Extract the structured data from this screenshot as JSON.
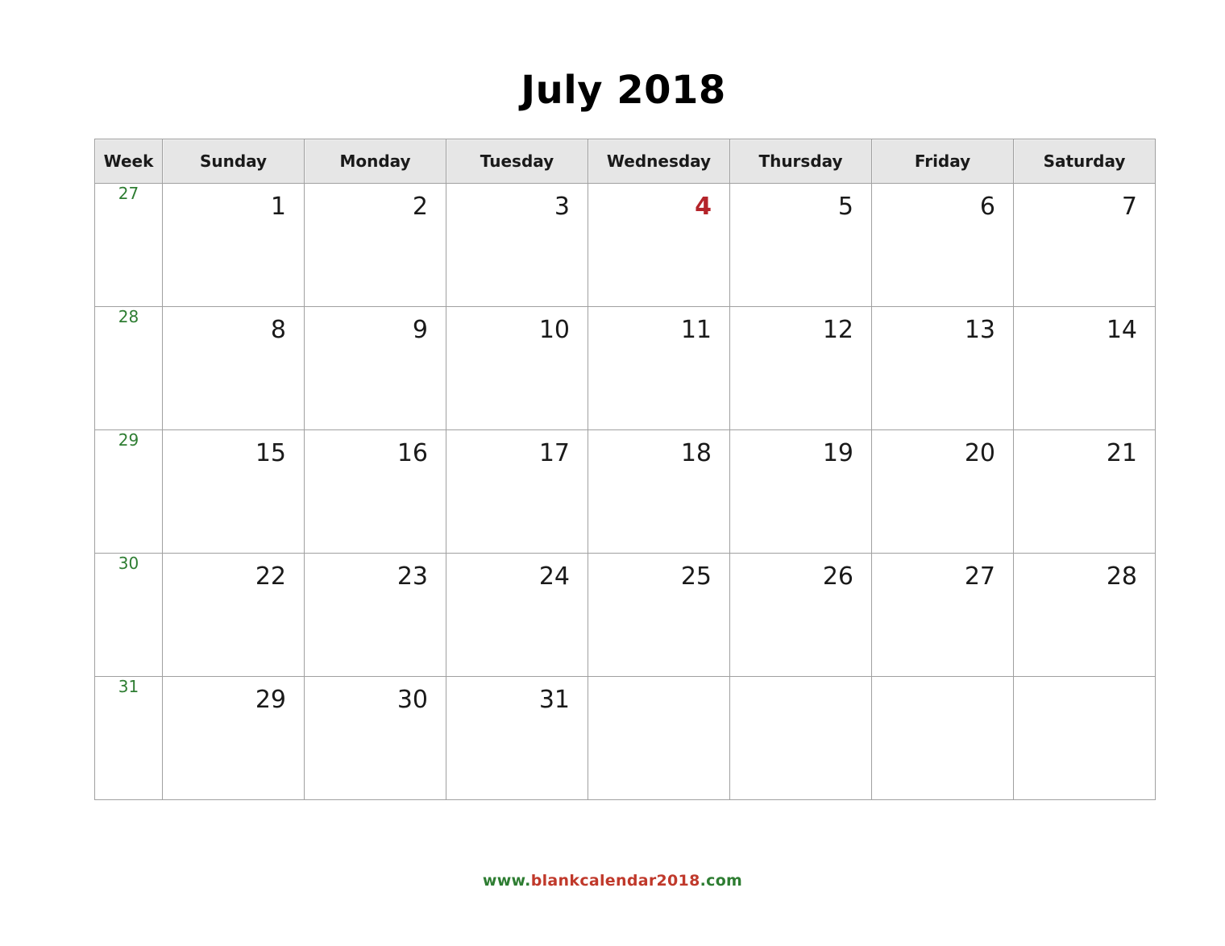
{
  "title": "July 2018",
  "headers": {
    "week": "Week",
    "days": [
      "Sunday",
      "Monday",
      "Tuesday",
      "Wednesday",
      "Thursday",
      "Friday",
      "Saturday"
    ]
  },
  "colors": {
    "week_number": "#2e7d32",
    "holiday": "#b4242a",
    "header_bg": "#e6e6e6",
    "grid_border": "#a0a0a0",
    "text": "#1a1a1a",
    "footer_green": "#2e7d32",
    "footer_red": "#c0392b"
  },
  "weeks": [
    {
      "week_number": "27",
      "days": [
        {
          "num": "1",
          "holiday": false
        },
        {
          "num": "2",
          "holiday": false
        },
        {
          "num": "3",
          "holiday": false
        },
        {
          "num": "4",
          "holiday": true
        },
        {
          "num": "5",
          "holiday": false
        },
        {
          "num": "6",
          "holiday": false
        },
        {
          "num": "7",
          "holiday": false
        }
      ]
    },
    {
      "week_number": "28",
      "days": [
        {
          "num": "8",
          "holiday": false
        },
        {
          "num": "9",
          "holiday": false
        },
        {
          "num": "10",
          "holiday": false
        },
        {
          "num": "11",
          "holiday": false
        },
        {
          "num": "12",
          "holiday": false
        },
        {
          "num": "13",
          "holiday": false
        },
        {
          "num": "14",
          "holiday": false
        }
      ]
    },
    {
      "week_number": "29",
      "days": [
        {
          "num": "15",
          "holiday": false
        },
        {
          "num": "16",
          "holiday": false
        },
        {
          "num": "17",
          "holiday": false
        },
        {
          "num": "18",
          "holiday": false
        },
        {
          "num": "19",
          "holiday": false
        },
        {
          "num": "20",
          "holiday": false
        },
        {
          "num": "21",
          "holiday": false
        }
      ]
    },
    {
      "week_number": "30",
      "days": [
        {
          "num": "22",
          "holiday": false
        },
        {
          "num": "23",
          "holiday": false
        },
        {
          "num": "24",
          "holiday": false
        },
        {
          "num": "25",
          "holiday": false
        },
        {
          "num": "26",
          "holiday": false
        },
        {
          "num": "27",
          "holiday": false
        },
        {
          "num": "28",
          "holiday": false
        }
      ]
    },
    {
      "week_number": "31",
      "days": [
        {
          "num": "29",
          "holiday": false
        },
        {
          "num": "30",
          "holiday": false
        },
        {
          "num": "31",
          "holiday": false
        },
        {
          "num": "",
          "holiday": false
        },
        {
          "num": "",
          "holiday": false
        },
        {
          "num": "",
          "holiday": false
        },
        {
          "num": "",
          "holiday": false
        }
      ]
    }
  ],
  "footer": {
    "prefix": "www.",
    "middle": "blankcalendar2018",
    "suffix": ".com"
  }
}
